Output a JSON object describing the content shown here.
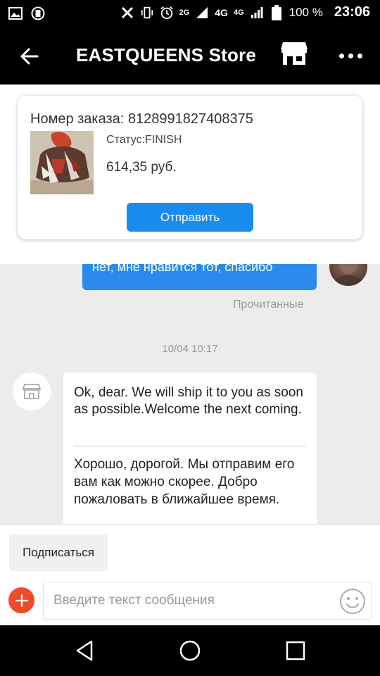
{
  "status_bar": {
    "battery": "100 %",
    "time": "23:06",
    "network_a": "2G",
    "network_b": "4G",
    "network_c": "4G",
    "icons": [
      "gallery-icon",
      "vibrate-icon",
      "no-sim-icon",
      "alarm-icon",
      "signal-icon",
      "battery-icon"
    ]
  },
  "app_bar": {
    "title": "EASTQUEENS Store"
  },
  "order": {
    "number_label": "Номер заказа: 8128991827408375",
    "status": "Статус:FINISH",
    "price": "614,35 руб.",
    "send_label": "Отправить"
  },
  "messages": {
    "outgoing_text": "нет, мне нравится тот, спасибо",
    "read_label": "Прочитанные",
    "timestamp": "10/04 10:17",
    "incoming_en": "Ok, dear. We will ship it to you as soon as possible.Welcome the next coming.",
    "incoming_ru": "Хорошо, дорогой. Мы отправим его вам как можно скорее. Добро пожаловать в ближайшее время."
  },
  "bottom": {
    "subscribe_label": "Подписаться",
    "input_placeholder": "Введите текст сообщения"
  },
  "colors": {
    "accent": "#1a8cf0",
    "bubble_out": "#2a8bec",
    "plus": "#f2492b",
    "chat_bg": "#ececec"
  }
}
